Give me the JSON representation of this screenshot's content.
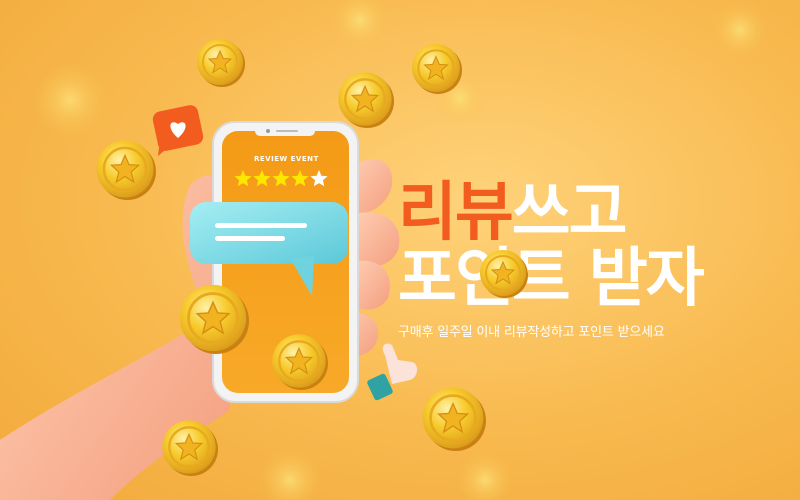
{
  "banner": {
    "headline_accent": "리뷰",
    "headline_rest": "쓰고",
    "headline_line2": "포인트 받자",
    "subtitle": "구매후 일주일 이내 리뷰작성하고 포인트 받으세요"
  },
  "phone": {
    "event_label": "REVIEW EVENT",
    "rating": 4,
    "rating_max": 5
  },
  "icons": [
    "coin-star-icon",
    "heart-bubble-icon",
    "chat-bubble-icon",
    "thumbs-up-icon",
    "star-icon"
  ],
  "colors": {
    "background": "#F8B94E",
    "accent": "#F25C1F",
    "phone_screen": "#F7A21E",
    "chat_bubble": "#7FD8E4",
    "coin": "#F5C21B"
  }
}
